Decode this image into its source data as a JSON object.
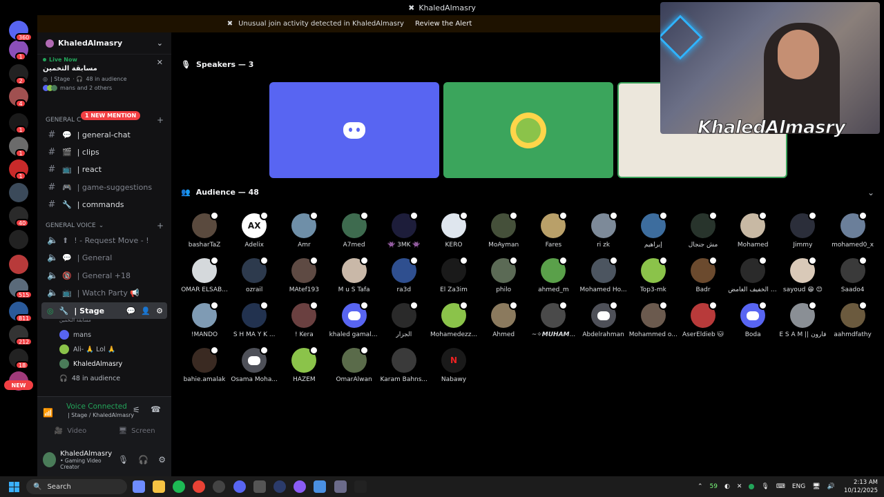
{
  "window": {
    "title": "KhaledAlmasry"
  },
  "alert": {
    "text": "Unusual join activity detected in KhaledAlmasry",
    "action": "Review the Alert"
  },
  "rail": {
    "badges": [
      "360",
      "1",
      "2",
      "4",
      "1",
      "1",
      "1",
      "40",
      "515",
      "811",
      "212",
      "18"
    ],
    "new_label": "NEW"
  },
  "server": {
    "name": "KhaledAlmasry"
  },
  "live": {
    "status": "Live Now",
    "title": "مسابقة التخمين",
    "meta_stage": "| Stage",
    "meta_audience": "48 in audience",
    "participants": "mans and 2 others"
  },
  "categories": {
    "general_chat_cat": "GENERAL C",
    "mention": "1 NEW MENTION",
    "general_voice_cat": "GENERAL VOICE"
  },
  "text_channels": [
    {
      "label": "| general-chat",
      "icon": "💬",
      "muted": false
    },
    {
      "label": "| clips",
      "icon": "🎬",
      "muted": false
    },
    {
      "label": "| react",
      "icon": "📺",
      "muted": false
    },
    {
      "label": "| game-suggestions",
      "icon": "🎮",
      "muted": true
    },
    {
      "label": "| commands",
      "icon": "🔧",
      "muted": false
    }
  ],
  "voice_channels": [
    {
      "label": "! - Request Move - !",
      "icon": "⬆"
    },
    {
      "label": "| General",
      "icon": "💬"
    },
    {
      "label": "| General +18",
      "icon": "🔞"
    },
    {
      "label": "| Watch Party 📢",
      "icon": "📺"
    }
  ],
  "stage_channel": {
    "label": "| Stage",
    "subtitle": "مسابقة التخمين"
  },
  "stage_users": [
    {
      "name": "mans",
      "color": "#5865f2"
    },
    {
      "name": "Ali- 🙏 Lol 🙏",
      "color": "#8bc34a"
    },
    {
      "name": "KhaledAlmasry",
      "color": "#4a7c59"
    }
  ],
  "stage_audience": "48 in audience",
  "voice_panel": {
    "status": "Voice Connected",
    "location": "| Stage / KhaledAlmasry",
    "video": "Video",
    "screen": "Screen"
  },
  "user": {
    "name": "KhaledAlmasry",
    "status": "• Gaming Video Creator"
  },
  "speakers": {
    "title": "Speakers — 3"
  },
  "audience": {
    "title": "Audience — 48"
  },
  "audience_members": [
    {
      "name": "basharTaZ",
      "color": "#5a4a3e"
    },
    {
      "name": "Adelix",
      "color": "#ffffff",
      "initials": "AX"
    },
    {
      "name": "Amr",
      "color": "#6f8fa8"
    },
    {
      "name": "A7med",
      "color": "#3e6b4f"
    },
    {
      "name": "👾 3MK 👾",
      "color": "#1d1d3a"
    },
    {
      "name": "KERO",
      "color": "#dfe6ee"
    },
    {
      "name": "MoAyman",
      "color": "#45503a"
    },
    {
      "name": "Fares",
      "color": "#b9a069"
    },
    {
      "name": "ri zk",
      "color": "#7d8a99"
    },
    {
      "name": "إبراهيم",
      "color": "#3d6d9e"
    },
    {
      "name": "مش جنجال",
      "color": "#28342c"
    },
    {
      "name": "Mohamed",
      "color": "#c8b9a4"
    },
    {
      "name": "Jimmy",
      "color": "#2b2e3a"
    },
    {
      "name": "mohamed0_x",
      "color": "#6b7f9a"
    },
    {
      "name": "OMAR ELSAB...",
      "color": "#d5d9dc"
    },
    {
      "name": "ozrail",
      "color": "#2d3a4d"
    },
    {
      "name": "MAtef193",
      "color": "#5e4a43"
    },
    {
      "name": "M u S Tafa",
      "color": "#c9b8a8"
    },
    {
      "name": "ra3d",
      "color": "#2f4f8f"
    },
    {
      "name": "El Za3im",
      "color": "#1a1a1a"
    },
    {
      "name": "philo",
      "color": "#5b6a55"
    },
    {
      "name": "ahmed_m",
      "color": "#5aa04a"
    },
    {
      "name": "Mohamed Ho...",
      "color": "#4c5560"
    },
    {
      "name": "Top3-mk",
      "color": "#8bc34a"
    },
    {
      "name": "Badr",
      "color": "#6b4a2e"
    },
    {
      "name": "المعقد المختلف عن الخفيف الغامض",
      "color": "#2a2a2a"
    },
    {
      "name": "sayoud 😁 😊",
      "color": "#d9c9b8"
    },
    {
      "name": "Saado4",
      "color": "#3a3a3a"
    },
    {
      "name": "!MANDO",
      "color": "#7f9bb4"
    },
    {
      "name": "S H MA Y K ...",
      "color": "#22324f"
    },
    {
      "name": "! Kera",
      "color": "#6a4040"
    },
    {
      "name": "khaled gamal ...",
      "color": "#5865f2",
      "discord": true
    },
    {
      "name": "الجزار",
      "color": "#2a2a2a"
    },
    {
      "name": "Mohamedezz...",
      "color": "#8bc34a"
    },
    {
      "name": "Ahmed",
      "color": "#8b7a5e"
    },
    {
      "name": "~✧𝙈𝙐𝙃𝘼𝙈...",
      "color": "#4a4a4a"
    },
    {
      "name": "Abdelrahman",
      "color": "#4e5058",
      "discord": true
    },
    {
      "name": "Mohammed o...",
      "color": "#6b5a4e"
    },
    {
      "name": "AserEldieb 🐱",
      "color": "#b83a3a"
    },
    {
      "name": "Boda",
      "color": "#5865f2",
      "discord": true
    },
    {
      "name": "E S A M || فارون",
      "color": "#8a8f95"
    },
    {
      "name": "aahmdfathy",
      "color": "#6b5a3e"
    },
    {
      "name": "bahie.amalak",
      "color": "#3a2a22"
    },
    {
      "name": "Osama Moha...",
      "color": "#4e5058",
      "discord": true
    },
    {
      "name": "HAZEM",
      "color": "#8bc34a"
    },
    {
      "name": "OmarAlwan",
      "color": "#5a6b4a"
    },
    {
      "name": "Karam Bahns...",
      "color": "#3a3a3a"
    },
    {
      "name": "Nabawy",
      "color": "#1a1a1a",
      "initials": "N"
    }
  ],
  "webcam": {
    "overlay_name": "KhaledAlmasry"
  },
  "taskbar": {
    "search": "Search",
    "tray_count": "59",
    "lang": "ENG",
    "time": "2:13 AM",
    "date": "10/12/2025"
  },
  "colors": {
    "accent": "#5865f2",
    "green": "#23a55a",
    "red": "#f23f43",
    "speaker2": "#3ba55c",
    "speaker3": "#ece7dc"
  }
}
